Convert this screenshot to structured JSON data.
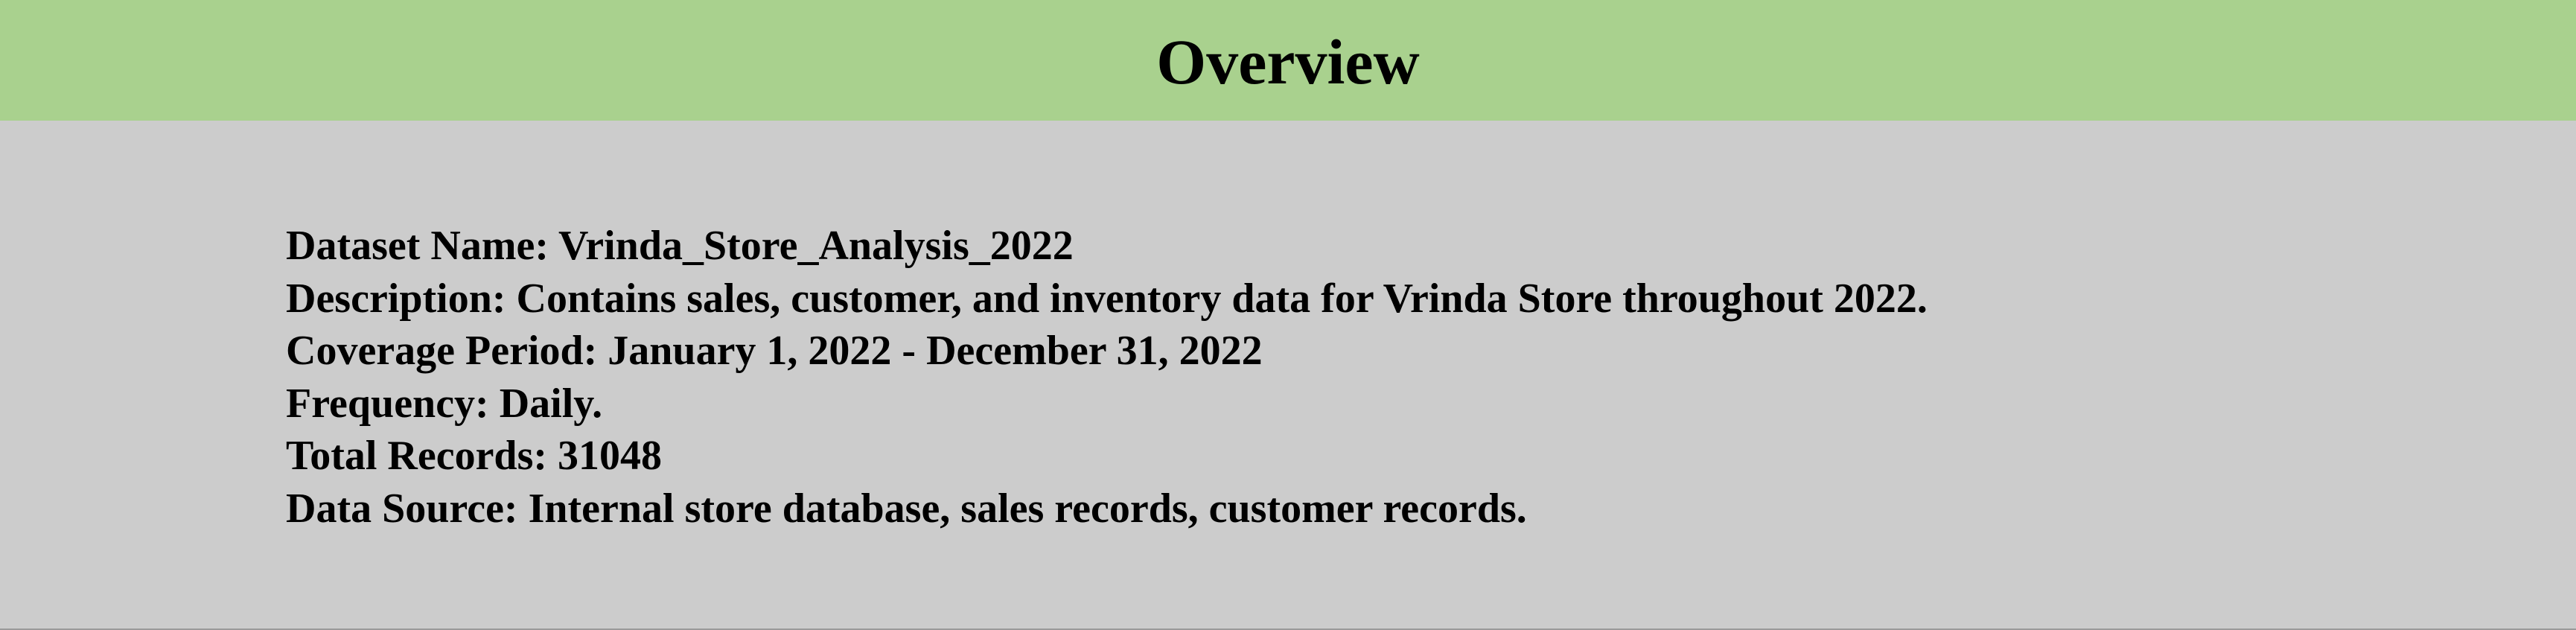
{
  "header": {
    "title": "Overview",
    "background_color": "#a9d18e"
  },
  "content": {
    "background_color": "#cccccc",
    "lines": [
      {
        "text": "Dataset Name: Vrinda_Store_Analysis_2022"
      },
      {
        "text": "Description: Contains sales, customer, and inventory data for Vrinda Store throughout 2022."
      },
      {
        "text": "Coverage Period: January 1, 2022 - December 31, 2022"
      },
      {
        "text": "Frequency: Daily."
      },
      {
        "text": "Total Records: 31048"
      },
      {
        "text": "Data Source: Internal store database, sales records, customer records."
      }
    ]
  }
}
